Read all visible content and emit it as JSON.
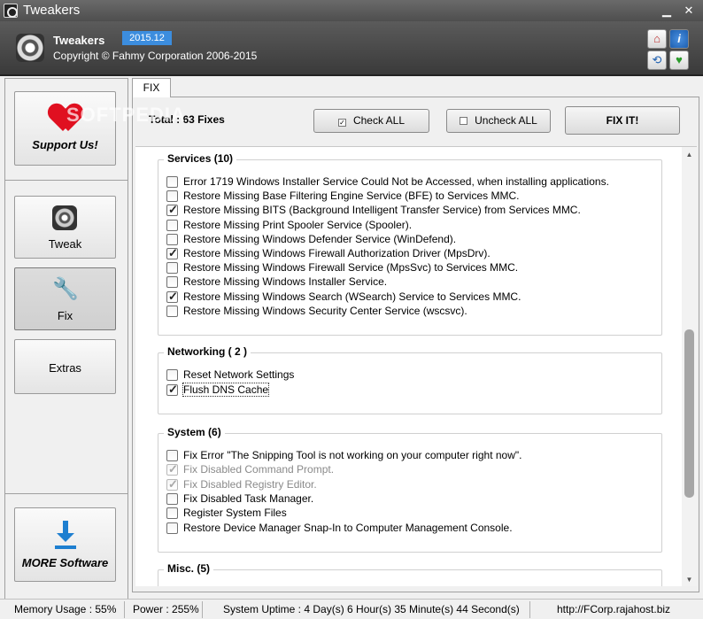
{
  "window": {
    "title": "Tweakers",
    "minimize_icon": "minimize-icon",
    "close_icon": "close-icon"
  },
  "header": {
    "name": "Tweakers",
    "version": "2015.12",
    "copyright": "Copyright © Fahmy Corporation 2006-2015",
    "buttons": [
      "home-icon",
      "info-icon",
      "refresh-icon",
      "heart-plus-icon"
    ]
  },
  "sidebar": {
    "support": "Support Us!",
    "tweak": "Tweak",
    "fix": "Fix",
    "extras": "Extras",
    "more": "MORE Software"
  },
  "watermark": "SOFTPEDIA",
  "tab": {
    "label": "FIX"
  },
  "toolbar": {
    "total": "Total : 63 Fixes",
    "check_all": "Check ALL",
    "uncheck_all": "Uncheck ALL",
    "fix_it": "FIX IT!"
  },
  "groups": {
    "services": {
      "title": "Services (10)",
      "items": [
        {
          "label": "Error 1719 Windows Installer Service Could Not be Accessed, when installing applications.",
          "checked": false
        },
        {
          "label": "Restore Missing Base Filtering Engine Service (BFE) to Services MMC.",
          "checked": false
        },
        {
          "label": "Restore Missing BITS (Background Intelligent Transfer Service) from Services MMC.",
          "checked": true
        },
        {
          "label": "Restore Missing Print Spooler Service (Spooler).",
          "checked": false
        },
        {
          "label": "Restore Missing Windows Defender Service (WinDefend).",
          "checked": false
        },
        {
          "label": "Restore Missing Windows Firewall Authorization Driver (MpsDrv).",
          "checked": true
        },
        {
          "label": "Restore Missing Windows Firewall Service (MpsSvc) to Services MMC.",
          "checked": false
        },
        {
          "label": "Restore Missing Windows Installer Service.",
          "checked": false
        },
        {
          "label": "Restore Missing Windows Search (WSearch) Service to Services MMC.",
          "checked": true
        },
        {
          "label": "Restore Missing Windows Security Center Service (wscsvc).",
          "checked": false
        }
      ]
    },
    "networking": {
      "title": "Networking ( 2 )",
      "items": [
        {
          "label": "Reset Network Settings",
          "checked": false
        },
        {
          "label": "Flush DNS Cache",
          "checked": true
        }
      ]
    },
    "system": {
      "title": "System (6)",
      "items": [
        {
          "label": "Fix Error \"The Snipping Tool is not working on your computer right now\".",
          "checked": false
        },
        {
          "label": "Fix Disabled Command Prompt.",
          "checked": true,
          "disabled": true
        },
        {
          "label": "Fix Disabled Registry Editor.",
          "checked": true,
          "disabled": true
        },
        {
          "label": "Fix Disabled Task Manager.",
          "checked": false
        },
        {
          "label": "Register System Files",
          "checked": false
        },
        {
          "label": "Restore Device Manager Snap-In to Computer Management Console.",
          "checked": false
        }
      ]
    },
    "misc": {
      "title": "Misc. (5)"
    }
  },
  "status": {
    "memory": "Memory Usage : 55%",
    "power": "Power : 255%",
    "uptime": "System Uptime : 4 Day(s) 6 Hour(s) 35 Minute(s) 44 Second(s)",
    "url": "http://FCorp.rajahost.biz"
  }
}
